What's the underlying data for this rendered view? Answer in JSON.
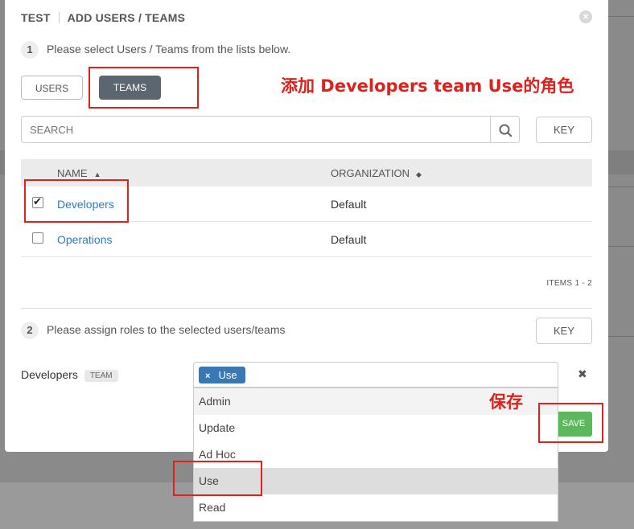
{
  "dialog": {
    "title_left": "TEST",
    "title_right": "ADD USERS / TEAMS",
    "close_icon": "close-icon"
  },
  "step1": {
    "number": "1",
    "text": "Please select Users / Teams from the lists below."
  },
  "tabs": {
    "users": "USERS",
    "teams": "TEAMS",
    "active": "teams"
  },
  "search": {
    "placeholder": "SEARCH",
    "key_label": "KEY"
  },
  "table": {
    "headers": {
      "name": "NAME",
      "organization": "ORGANIZATION"
    },
    "rows": [
      {
        "name": "Developers",
        "organization": "Default",
        "checked": true
      },
      {
        "name": "Operations",
        "organization": "Default",
        "checked": false
      }
    ],
    "items_text": "ITEMS  1 - 2"
  },
  "step2": {
    "number": "2",
    "text": "Please assign roles to the selected users/teams",
    "key_label": "KEY"
  },
  "assignment": {
    "target": "Developers",
    "badge": "TEAM",
    "selected_role": "Use",
    "remove_tag": "×",
    "remove_row": "✖"
  },
  "role_options": [
    "Admin",
    "Update",
    "Ad Hoc",
    "Use",
    "Read"
  ],
  "save_label": "SAVE",
  "annotations": {
    "add_role": "添加 Developers team Use的角色",
    "save": "保存"
  },
  "colors": {
    "accent_red": "#e0201b",
    "save_green": "#5cb85c",
    "tag_blue": "#3a78b5",
    "link_blue": "#337ab7"
  }
}
